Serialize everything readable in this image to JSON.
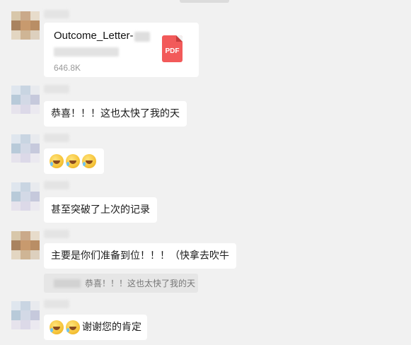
{
  "file_message": {
    "file_name": "Outcome_Letter-",
    "file_size": "646.8K",
    "file_icon": "pdf-icon",
    "file_icon_label": "PDF",
    "icon_color": "#f25a5a"
  },
  "messages": [
    {
      "text": "恭喜！！！这也太快了我的天"
    },
    {
      "emoji": [
        "laugh-cry-emoji",
        "laugh-cry-emoji",
        "laugh-cry-emoji"
      ]
    },
    {
      "text": "甚至突破了上次的记录"
    },
    {
      "text": "主要是你们准备到位！！！（快拿去吹牛"
    },
    {
      "text": "谢谢您的肯定",
      "emoji": [
        "laugh-cry-emoji",
        "laugh-cry-emoji"
      ]
    }
  ],
  "quoted_message": {
    "text": "恭喜！！！这也太快了我的天"
  },
  "colors": {
    "background": "#f1f1f1",
    "bubble": "#ffffff",
    "quote_bg": "#e6e6e6"
  }
}
